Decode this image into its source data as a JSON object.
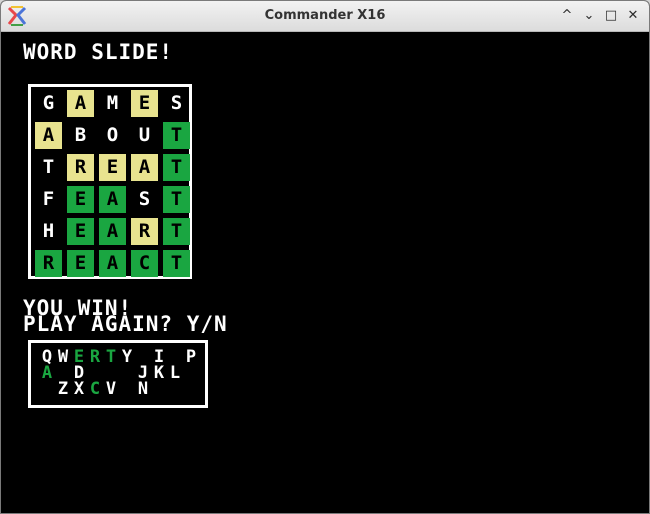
{
  "window": {
    "title": "Commander X16",
    "controls": [
      "^",
      "⌄",
      "□",
      "✕"
    ]
  },
  "game": {
    "title": "WORD SLIDE!",
    "status_line1": "YOU WIN!",
    "status_line2": "PLAY AGAIN? Y/N"
  },
  "board": {
    "rows": [
      [
        {
          "l": "G",
          "s": "none"
        },
        {
          "l": "A",
          "s": "yellow"
        },
        {
          "l": "M",
          "s": "none"
        },
        {
          "l": "E",
          "s": "yellow"
        },
        {
          "l": "S",
          "s": "none"
        }
      ],
      [
        {
          "l": "A",
          "s": "yellow"
        },
        {
          "l": "B",
          "s": "none"
        },
        {
          "l": "O",
          "s": "none"
        },
        {
          "l": "U",
          "s": "none"
        },
        {
          "l": "T",
          "s": "green"
        }
      ],
      [
        {
          "l": "T",
          "s": "none"
        },
        {
          "l": "R",
          "s": "yellow"
        },
        {
          "l": "E",
          "s": "yellow"
        },
        {
          "l": "A",
          "s": "yellow"
        },
        {
          "l": "T",
          "s": "green"
        }
      ],
      [
        {
          "l": "F",
          "s": "none"
        },
        {
          "l": "E",
          "s": "green"
        },
        {
          "l": "A",
          "s": "green"
        },
        {
          "l": "S",
          "s": "none"
        },
        {
          "l": "T",
          "s": "green"
        }
      ],
      [
        {
          "l": "H",
          "s": "none"
        },
        {
          "l": "E",
          "s": "green"
        },
        {
          "l": "A",
          "s": "green"
        },
        {
          "l": "R",
          "s": "yellow"
        },
        {
          "l": "T",
          "s": "green"
        }
      ],
      [
        {
          "l": "R",
          "s": "green"
        },
        {
          "l": "E",
          "s": "green"
        },
        {
          "l": "A",
          "s": "green"
        },
        {
          "l": "C",
          "s": "green"
        },
        {
          "l": "T",
          "s": "green"
        }
      ]
    ]
  },
  "keyboard": {
    "rows": [
      [
        {
          "k": "Q",
          "s": "white"
        },
        {
          "k": "W",
          "s": "white"
        },
        {
          "k": "E",
          "s": "green"
        },
        {
          "k": "R",
          "s": "green"
        },
        {
          "k": "T",
          "s": "green"
        },
        {
          "k": "Y",
          "s": "white"
        },
        {
          "k": "",
          "s": "hidden"
        },
        {
          "k": "I",
          "s": "white"
        },
        {
          "k": "",
          "s": "hidden"
        },
        {
          "k": "P",
          "s": "white"
        }
      ],
      [
        {
          "k": "A",
          "s": "green"
        },
        {
          "k": "",
          "s": "hidden"
        },
        {
          "k": "D",
          "s": "white"
        },
        {
          "k": "",
          "s": "hidden"
        },
        {
          "k": "",
          "s": "hidden"
        },
        {
          "k": "",
          "s": "hidden"
        },
        {
          "k": "J",
          "s": "white"
        },
        {
          "k": "K",
          "s": "white"
        },
        {
          "k": "L",
          "s": "white"
        }
      ],
      [
        {
          "k": "Z",
          "s": "white"
        },
        {
          "k": "X",
          "s": "white"
        },
        {
          "k": "C",
          "s": "green"
        },
        {
          "k": "V",
          "s": "white"
        },
        {
          "k": "",
          "s": "hidden"
        },
        {
          "k": "N",
          "s": "white"
        },
        {
          "k": "",
          "s": "hidden"
        }
      ]
    ]
  },
  "colors": {
    "yellow": "#e8e38f",
    "green": "#1aa641",
    "background": "#000000",
    "text": "#ffffff"
  }
}
